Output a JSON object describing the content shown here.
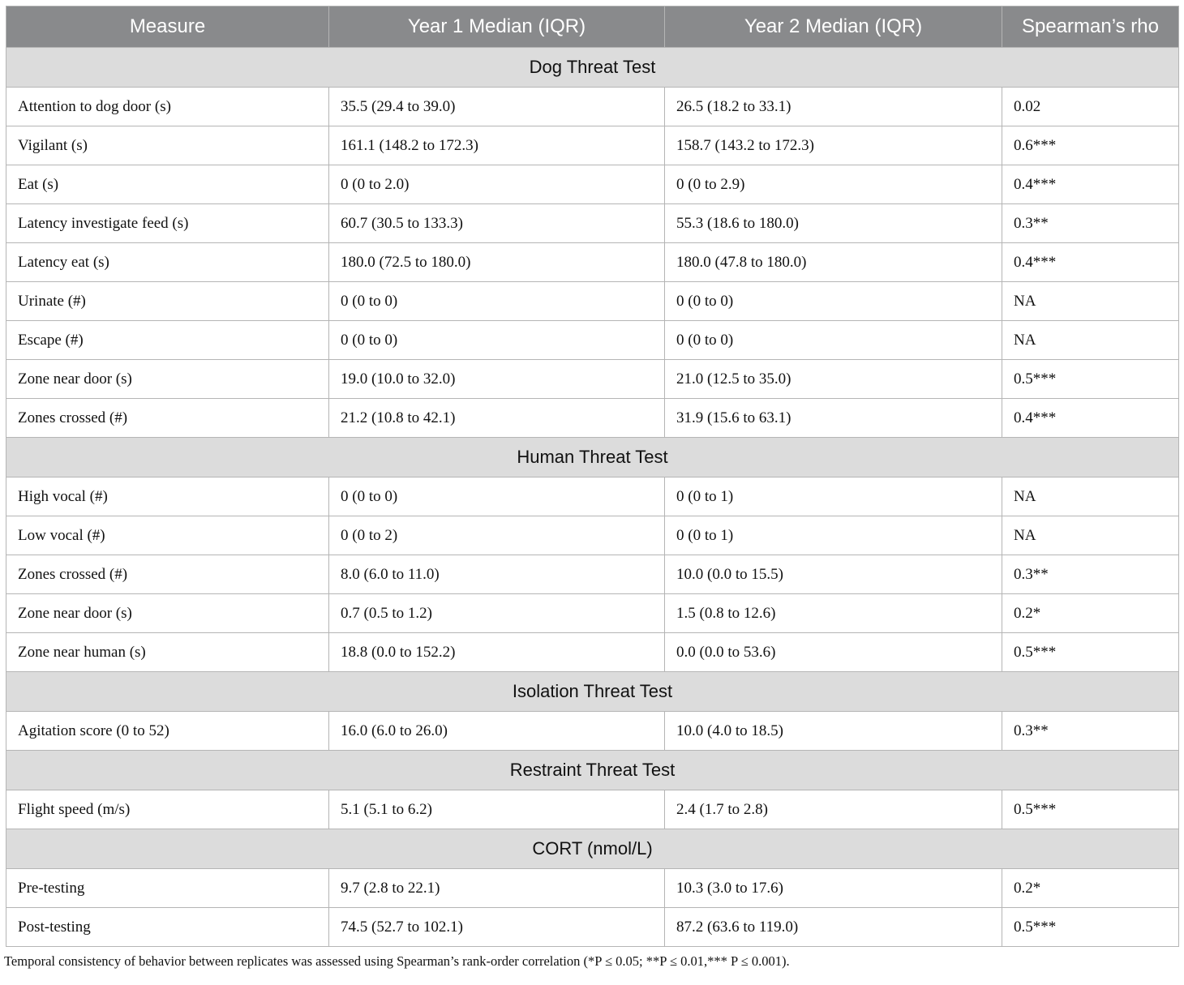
{
  "table": {
    "headers": [
      "Measure",
      "Year 1 Median (IQR)",
      "Year 2 Median (IQR)",
      "Spearman’s rho"
    ],
    "sections": [
      {
        "title": "Dog Threat Test",
        "rows": [
          [
            "Attention to dog door (s)",
            "35.5 (29.4 to 39.0)",
            "26.5 (18.2 to 33.1)",
            "0.02"
          ],
          [
            "Vigilant (s)",
            "161.1 (148.2 to 172.3)",
            "158.7 (143.2 to 172.3)",
            "0.6***"
          ],
          [
            "Eat (s)",
            "0 (0 to 2.0)",
            "0 (0 to 2.9)",
            "0.4***"
          ],
          [
            "Latency investigate feed (s)",
            "60.7 (30.5 to 133.3)",
            "55.3 (18.6 to 180.0)",
            "0.3**"
          ],
          [
            "Latency eat (s)",
            "180.0 (72.5 to 180.0)",
            "180.0 (47.8 to 180.0)",
            "0.4***"
          ],
          [
            "Urinate (#)",
            "0 (0 to 0)",
            "0 (0 to 0)",
            "NA"
          ],
          [
            "Escape (#)",
            "0 (0 to 0)",
            "0 (0 to 0)",
            "NA"
          ],
          [
            "Zone near door (s)",
            "19.0 (10.0 to 32.0)",
            "21.0 (12.5 to 35.0)",
            "0.5***"
          ],
          [
            "Zones crossed (#)",
            "21.2 (10.8 to 42.1)",
            "31.9 (15.6 to 63.1)",
            "0.4***"
          ]
        ]
      },
      {
        "title": "Human Threat Test",
        "rows": [
          [
            "High vocal (#)",
            "0 (0 to 0)",
            "0 (0 to 1)",
            "NA"
          ],
          [
            "Low vocal (#)",
            "0 (0 to 2)",
            "0 (0 to 1)",
            "NA"
          ],
          [
            "Zones crossed (#)",
            "8.0 (6.0 to 11.0)",
            "10.0 (0.0 to 15.5)",
            "0.3**"
          ],
          [
            "Zone near door (s)",
            "0.7 (0.5 to 1.2)",
            "1.5 (0.8 to 12.6)",
            "0.2*"
          ],
          [
            "Zone near human (s)",
            "18.8 (0.0 to 152.2)",
            "0.0 (0.0 to 53.6)",
            "0.5***"
          ]
        ]
      },
      {
        "title": "Isolation Threat Test",
        "rows": [
          [
            "Agitation score (0 to 52)",
            "16.0 (6.0 to 26.0)",
            "10.0 (4.0 to 18.5)",
            "0.3**"
          ]
        ]
      },
      {
        "title": "Restraint Threat Test",
        "rows": [
          [
            "Flight speed (m/s)",
            "5.1 (5.1 to 6.2)",
            "2.4 (1.7 to 2.8)",
            "0.5***"
          ]
        ]
      },
      {
        "title": "CORT (nmol/L)",
        "rows": [
          [
            "Pre-testing",
            "9.7 (2.8 to 22.1)",
            "10.3 (3.0 to 17.6)",
            "0.2*"
          ],
          [
            "Post-testing",
            "74.5 (52.7 to 102.1)",
            "87.2 (63.6 to 119.0)",
            "0.5***"
          ]
        ]
      }
    ]
  },
  "caption": "Temporal consistency of behavior between replicates was assessed using Spearman’s rank-order correlation (*P ≤ 0.05; **P ≤ 0.01,*** P ≤ 0.001)."
}
